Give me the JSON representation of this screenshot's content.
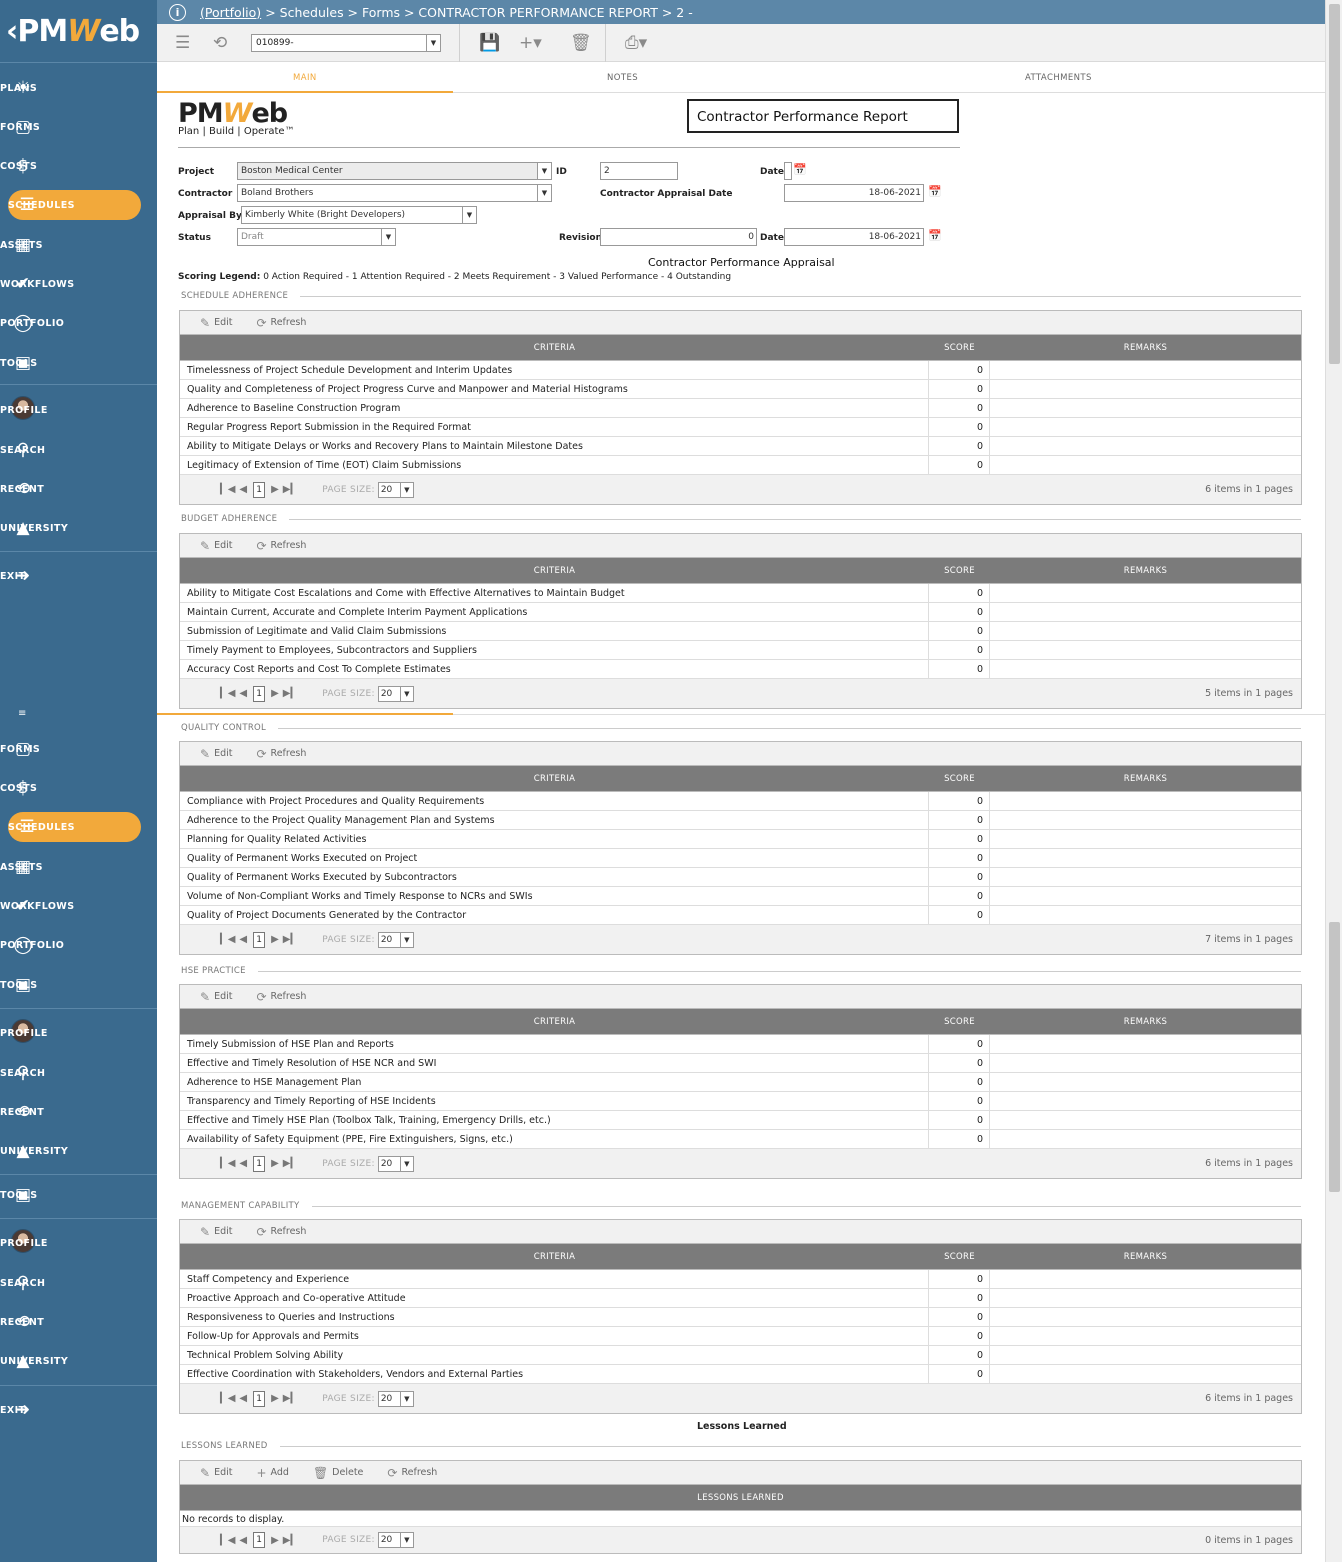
{
  "app": {
    "logo_text": "PMWeb"
  },
  "sidebar": {
    "items": [
      {
        "label": "PLANS",
        "icon": "bulb-icon"
      },
      {
        "label": "FORMS",
        "icon": "document-icon"
      },
      {
        "label": "COSTS",
        "icon": "dollar-icon"
      },
      {
        "label": "SCHEDULES",
        "icon": "schedule-icon"
      },
      {
        "label": "ASSETS",
        "icon": "building-icon"
      },
      {
        "label": "WORKFLOWS",
        "icon": "check-icon"
      },
      {
        "label": "PORTFOLIO",
        "icon": "globe-icon"
      },
      {
        "label": "TOOLS",
        "icon": "toolbox-icon"
      },
      {
        "label": "PROFILE",
        "icon": "avatar"
      },
      {
        "label": "SEARCH",
        "icon": "search-icon"
      },
      {
        "label": "RECENT",
        "icon": "history-icon"
      },
      {
        "label": "UNIVERSITY",
        "icon": "graduation-cap-icon"
      },
      {
        "label": "EXIT",
        "icon": "exit-icon"
      }
    ],
    "items2": [
      {
        "label": "FORMS"
      },
      {
        "label": "COSTS"
      },
      {
        "label": "SCHEDULES"
      },
      {
        "label": "ASSETS"
      },
      {
        "label": "WORKFLOWS"
      },
      {
        "label": "PORTFOLIO"
      },
      {
        "label": "TOOLS"
      },
      {
        "label": "PROFILE"
      },
      {
        "label": "SEARCH"
      },
      {
        "label": "RECENT"
      },
      {
        "label": "UNIVERSITY"
      },
      {
        "label": "TOOLS"
      },
      {
        "label": "PROFILE"
      },
      {
        "label": "SEARCH"
      },
      {
        "label": "RECENT"
      },
      {
        "label": "UNIVERSITY"
      },
      {
        "label": "EXIT"
      }
    ],
    "collapsed_marker": "≡"
  },
  "breadcrumb": {
    "portfolio": "(Portfolio)",
    "rest": "> Schedules > Forms > CONTRACTOR PERFORMANCE REPORT > 2 -"
  },
  "toolbar": {
    "record_select": "010899-"
  },
  "tabs": [
    {
      "label": "MAIN"
    },
    {
      "label": "NOTES"
    },
    {
      "label": "ATTACHMENTS"
    }
  ],
  "brand": {
    "logo": "PMWeb",
    "tagline": "Plan | Build | Operate™"
  },
  "report_title": "Contractor Performance Report",
  "form": {
    "project_label": "Project",
    "project_value": "Boston Medical Center",
    "id_label": "ID",
    "id_value": "2",
    "date_label": "Date",
    "contractor_label": "Contractor",
    "contractor_value": "Boland Brothers",
    "appraisal_date_label": "Contractor Appraisal Date",
    "appraisal_date_value": "18-06-2021",
    "appraisal_by_label": "Appraisal By",
    "appraisal_by_value": "Kimberly White (Bright Developers)",
    "status_label": "Status",
    "status_value": "Draft",
    "revision_label": "Revision",
    "revision_value": "0",
    "date2_label": "Date",
    "date2_value": "18-06-2021"
  },
  "appraisal_title": "Contractor Performance Appraisal",
  "legend": {
    "label": "Scoring Legend:",
    "text": "0 Action Required - 1 Attention Required - 2 Meets Requirement - 3 Valued Performance - 4 Outstanding"
  },
  "grid_labels": {
    "edit": "Edit",
    "refresh": "Refresh",
    "add": "Add",
    "delete": "Delete",
    "criteria": "CRITERIA",
    "score": "SCORE",
    "remarks": "REMARKS",
    "page_size": "PAGE SIZE:",
    "page_size_value": "20",
    "page": "1"
  },
  "sections": [
    {
      "title": "SCHEDULE ADHERENCE",
      "items_text": "6 items in 1 pages",
      "rows": [
        {
          "criteria": "Timelessness of Project Schedule Development and Interim Updates",
          "score": "0"
        },
        {
          "criteria": "Quality and Completeness of Project Progress Curve and Manpower and Material Histograms",
          "score": "0"
        },
        {
          "criteria": "Adherence to Baseline Construction Program",
          "score": "0"
        },
        {
          "criteria": "Regular Progress Report Submission in the Required Format",
          "score": "0"
        },
        {
          "criteria": "Ability to Mitigate Delays or Works and Recovery Plans to Maintain Milestone Dates",
          "score": "0"
        },
        {
          "criteria": "Legitimacy of Extension of Time (EOT) Claim Submissions",
          "score": "0"
        }
      ]
    },
    {
      "title": "BUDGET ADHERENCE",
      "items_text": "5 items in 1 pages",
      "rows": [
        {
          "criteria": "Ability to Mitigate Cost Escalations and Come with Effective Alternatives to Maintain Budget",
          "score": "0"
        },
        {
          "criteria": "Maintain Current, Accurate and Complete Interim Payment Applications",
          "score": "0"
        },
        {
          "criteria": "Submission of Legitimate and Valid Claim Submissions",
          "score": "0"
        },
        {
          "criteria": "Timely Payment to Employees, Subcontractors and Suppliers",
          "score": "0"
        },
        {
          "criteria": "Accuracy Cost Reports and Cost To Complete Estimates",
          "score": "0"
        }
      ]
    },
    {
      "title": "QUALITY CONTROL",
      "items_text": "7 items in 1 pages",
      "rows": [
        {
          "criteria": "Compliance with Project Procedures and Quality Requirements",
          "score": "0"
        },
        {
          "criteria": "Adherence to the Project Quality Management Plan and Systems",
          "score": "0"
        },
        {
          "criteria": "Planning for Quality Related Activities",
          "score": "0"
        },
        {
          "criteria": "Quality of Permanent Works Executed on Project",
          "score": "0"
        },
        {
          "criteria": "Quality of Permanent Works Executed by Subcontractors",
          "score": "0"
        },
        {
          "criteria": "Volume of Non-Compliant Works and Timely Response to NCRs and SWIs",
          "score": "0"
        },
        {
          "criteria": "Quality of Project Documents Generated by the Contractor",
          "score": "0"
        }
      ]
    },
    {
      "title": "HSE PRACTICE",
      "items_text": "6 items in 1 pages",
      "rows": [
        {
          "criteria": "Timely Submission of HSE Plan and Reports",
          "score": "0"
        },
        {
          "criteria": "Effective and Timely Resolution of HSE NCR and SWI",
          "score": "0"
        },
        {
          "criteria": "Adherence to HSE Management Plan",
          "score": "0"
        },
        {
          "criteria": "Transparency and Timely Reporting of HSE Incidents",
          "score": "0"
        },
        {
          "criteria": "Effective and Timely HSE Plan (Toolbox Talk, Training, Emergency Drills, etc.)",
          "score": "0"
        },
        {
          "criteria": "Availability of Safety Equipment (PPE, Fire Extinguishers, Signs, etc.)",
          "score": "0"
        }
      ]
    },
    {
      "title": "MANAGEMENT CAPABILITY",
      "items_text": "6 items in 1 pages",
      "rows": [
        {
          "criteria": "Staff Competency and Experience",
          "score": "0"
        },
        {
          "criteria": "Proactive Approach and Co-operative Attitude",
          "score": "0"
        },
        {
          "criteria": "Responsiveness to Queries and Instructions",
          "score": "0"
        },
        {
          "criteria": "Follow-Up for Approvals and Permits",
          "score": "0"
        },
        {
          "criteria": "Technical Problem Solving Ability",
          "score": "0"
        },
        {
          "criteria": "Effective Coordination with Stakeholders, Vendors and External Parties",
          "score": "0"
        }
      ]
    }
  ],
  "lessons": {
    "heading": "Lessons Learned",
    "section_title": "LESSONS LEARNED",
    "column": "LESSONS LEARNED",
    "no_records": "No records to display.",
    "items_text": "0 items in 1 pages"
  },
  "colors": {
    "sidebar": "#3a6a8e",
    "accent": "#f2a93b",
    "topbar": "#5c87a8",
    "grid_header": "#7b7b7b"
  }
}
